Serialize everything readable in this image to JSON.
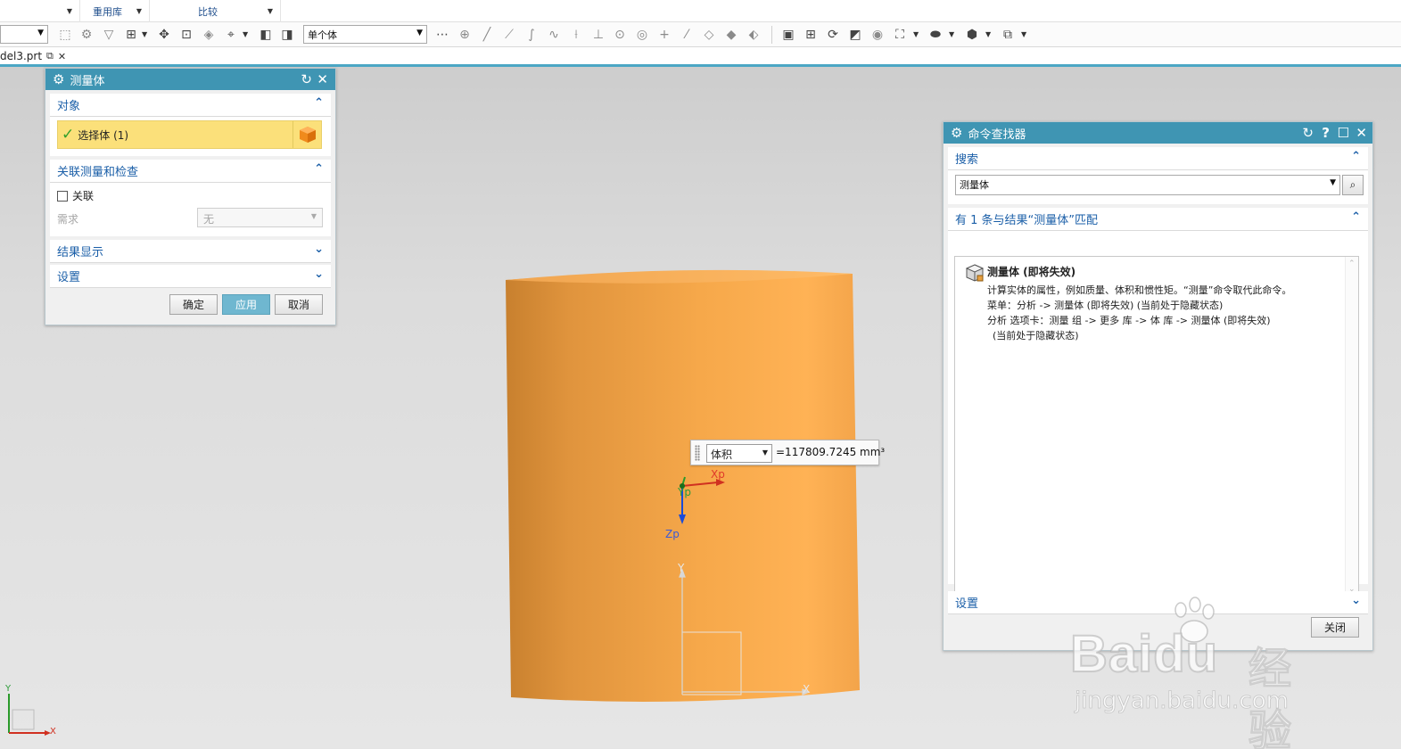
{
  "ribbon": {
    "groups": [
      {
        "label": ""
      },
      {
        "label": "重用库"
      },
      {
        "label": "比较"
      }
    ]
  },
  "toolbar": {
    "left_combo": "",
    "filter_combo": "单个体",
    "more_icon": "⋯"
  },
  "doc_tab": {
    "label": "del3.prt"
  },
  "measure_dialog": {
    "title": "测量体",
    "section_object": "对象",
    "select_body": "选择体 (1)",
    "section_assoc": "关联测量和检查",
    "assoc_checkbox": "关联",
    "requirement_label": "需求",
    "requirement_value": "无",
    "section_results": "结果显示",
    "section_settings": "设置",
    "ok": "确定",
    "apply": "应用",
    "cancel": "取消"
  },
  "viewport": {
    "measure_type": "体积",
    "measure_value": "=117809.7245 mm³",
    "xp": "Xp",
    "yp": "Yp",
    "zp": "Zp",
    "y": "Y",
    "x": "X",
    "mini_y": "Y",
    "mini_x": "X"
  },
  "finder_dialog": {
    "title": "命令查找器",
    "section_search": "搜索",
    "search_value": "测量体",
    "results_header": "有 1 条与结果“测量体”匹配",
    "result_title": "测量体 (即将失效)",
    "result_line1": "计算实体的属性，例如质量、体积和惯性矩。“测量”命令取代此命令。",
    "result_line2": "菜单：分析   -> 测量体 (即将失效)   (当前处于隐藏状态)",
    "result_line3": "分析 选项卡：测量 组 -> 更多 库 -> 体 库 -> 测量体 (即将失效)",
    "result_line4": "(当前处于隐藏状态)",
    "section_settings": "设置",
    "close": "关闭"
  },
  "watermark": {
    "brand": "Baidu",
    "cn": "经验",
    "url": "jingyan.baidu.com"
  },
  "colors": {
    "dialog_title": "#3f95b3",
    "selection_highlight": "#fbe07a",
    "body_orange": "#f0a040",
    "section_blue": "#1b5fa8"
  }
}
